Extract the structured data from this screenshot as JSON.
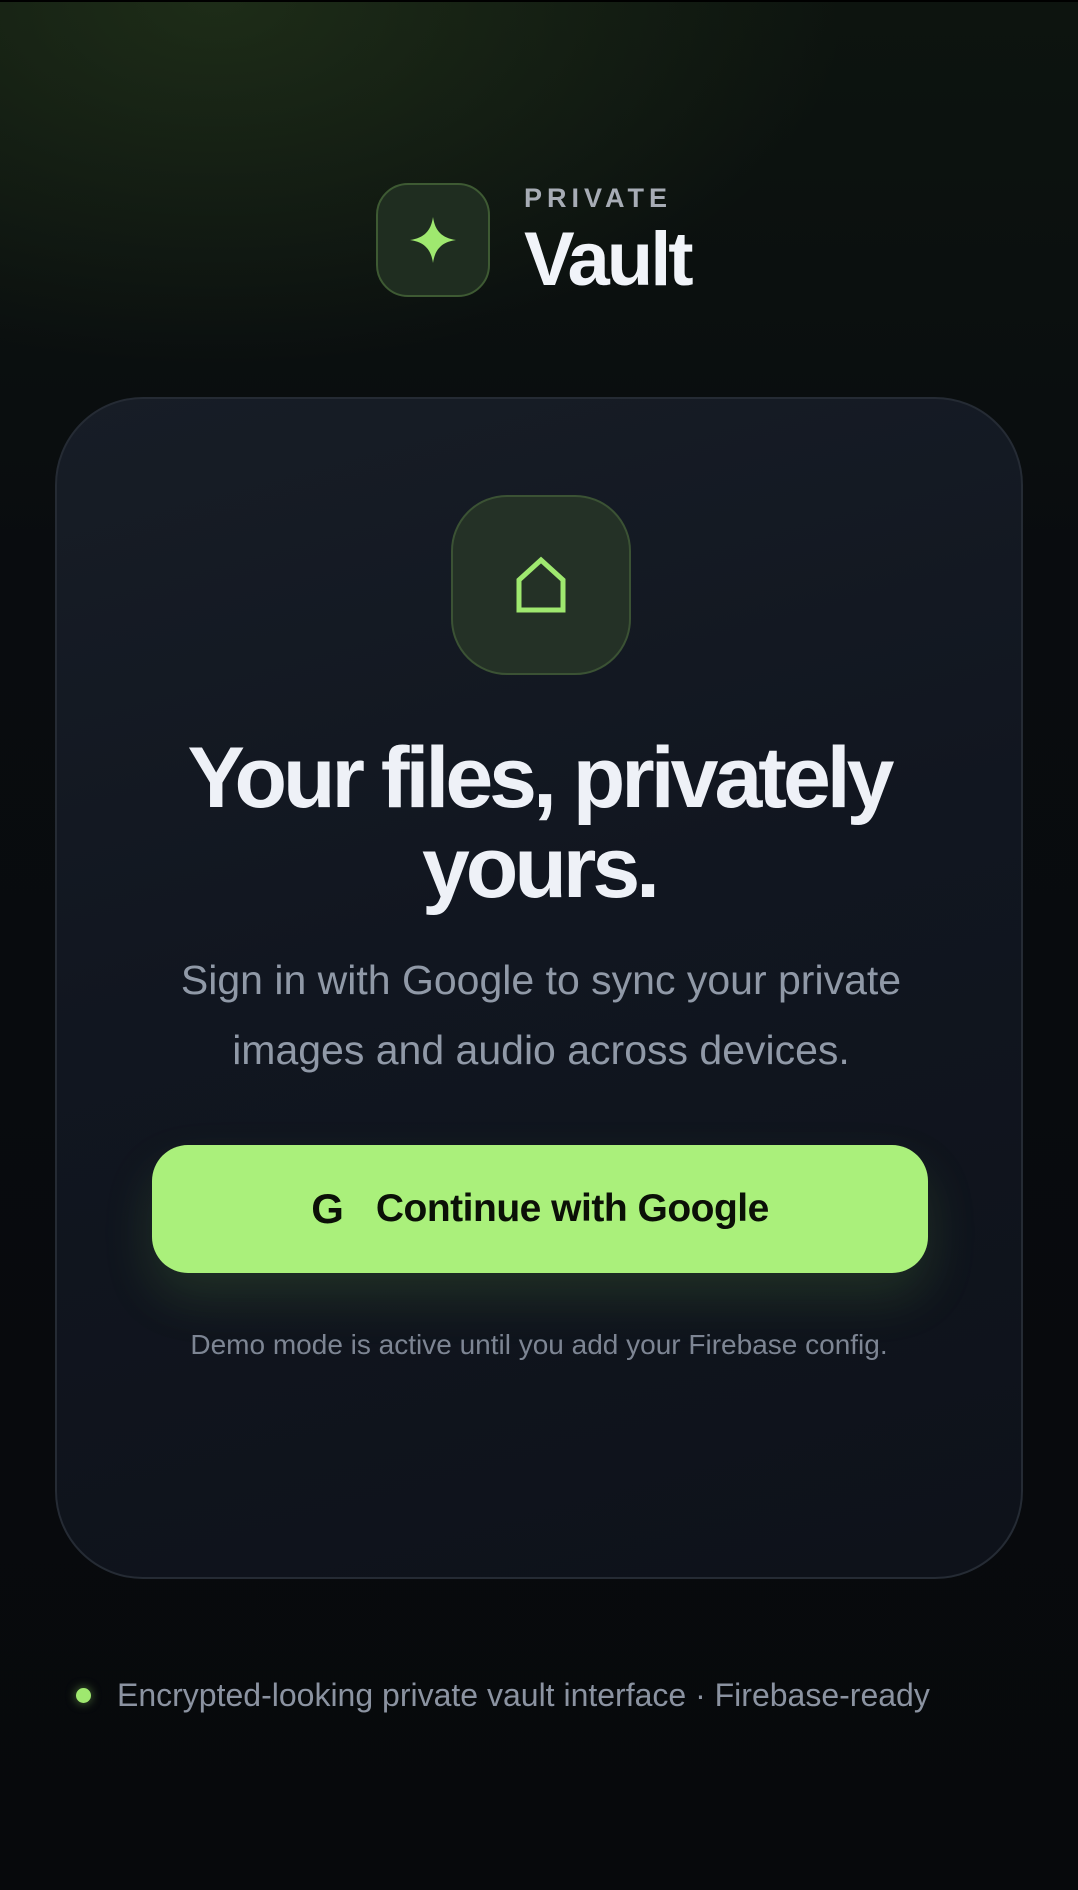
{
  "brand": {
    "eyebrow": "PRIVATE",
    "title": "Vault",
    "logo_icon": "sparkle-icon"
  },
  "card": {
    "icon": "home-icon",
    "headline_line1": "Your files, privately",
    "headline_line2": "yours.",
    "subtitle_line1": "Sign in with Google to sync your private",
    "subtitle_line2": "images and audio across devices.",
    "google_button": {
      "glyph": "G",
      "label": "Continue with Google"
    },
    "demo_note": "Demo mode is active until you add your Firebase config."
  },
  "footer": {
    "text": "Encrypted-looking private vault interface · Firebase-ready"
  },
  "colors": {
    "accent": "#aaf07b",
    "background": "#07090c",
    "card": "#121720",
    "text_primary": "#eef1f7",
    "text_secondary": "#9099a7"
  }
}
